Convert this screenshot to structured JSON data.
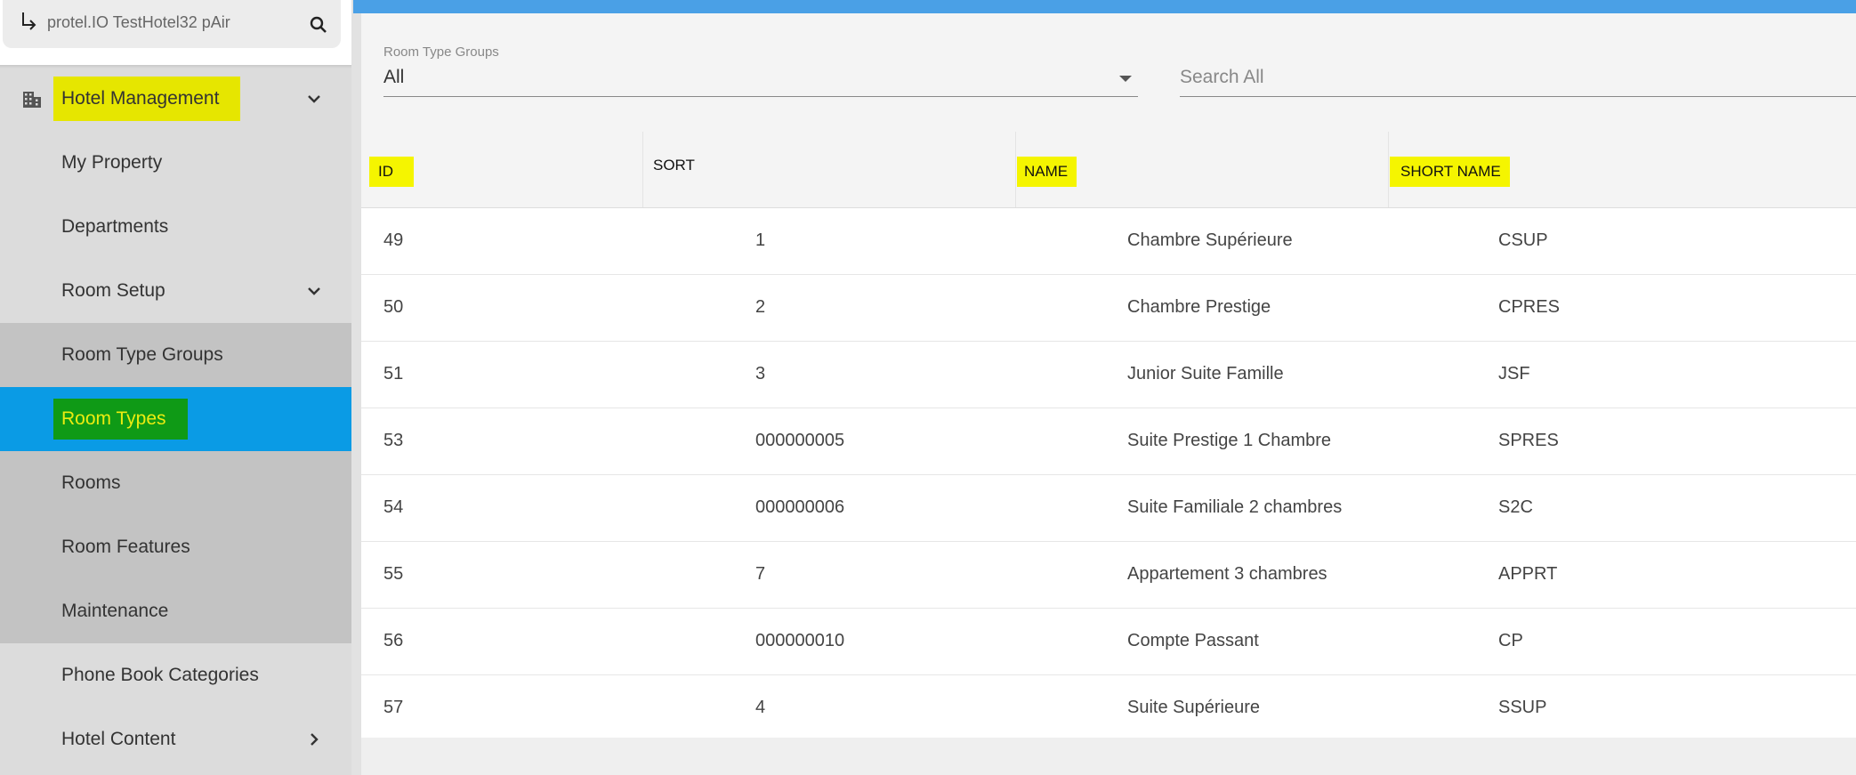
{
  "hotel": {
    "name": "protel.IO TestHotel32 pAir"
  },
  "sidebar": {
    "items": [
      {
        "label": "Hotel Management"
      },
      {
        "label": "My Property"
      },
      {
        "label": "Departments"
      },
      {
        "label": "Room Setup"
      },
      {
        "label": "Room Type Groups"
      },
      {
        "label": "Room Types"
      },
      {
        "label": "Rooms"
      },
      {
        "label": "Room Features"
      },
      {
        "label": "Maintenance"
      },
      {
        "label": "Phone Book Categories"
      },
      {
        "label": "Hotel Content"
      }
    ]
  },
  "filters": {
    "room_type_groups_label": "Room Type Groups",
    "room_type_groups_value": "All",
    "search_placeholder": "Search All"
  },
  "table": {
    "columns": [
      "ID",
      "SORT",
      "NAME",
      "SHORT NAME"
    ],
    "rows": [
      {
        "id": "49",
        "sort": "1",
        "name": "Chambre Supérieure",
        "short": "CSUP"
      },
      {
        "id": "50",
        "sort": "2",
        "name": "Chambre Prestige",
        "short": "CPRES"
      },
      {
        "id": "51",
        "sort": "3",
        "name": "Junior Suite Famille",
        "short": "JSF"
      },
      {
        "id": "53",
        "sort": "000000005",
        "name": "Suite Prestige 1 Chambre",
        "short": "SPRES"
      },
      {
        "id": "54",
        "sort": "000000006",
        "name": "Suite Familiale 2 chambres",
        "short": "S2C"
      },
      {
        "id": "55",
        "sort": "7",
        "name": "Appartement 3 chambres",
        "short": "APPRT"
      },
      {
        "id": "56",
        "sort": "000000010",
        "name": "Compte Passant",
        "short": "CP"
      },
      {
        "id": "57",
        "sort": "4",
        "name": "Suite Supérieure",
        "short": "SSUP"
      }
    ]
  },
  "colors": {
    "topbar": "#4aa0e6",
    "active_nav": "#0a9be5",
    "highlight_yellow": "#f5f500",
    "highlight_green": "#0f9a16"
  }
}
